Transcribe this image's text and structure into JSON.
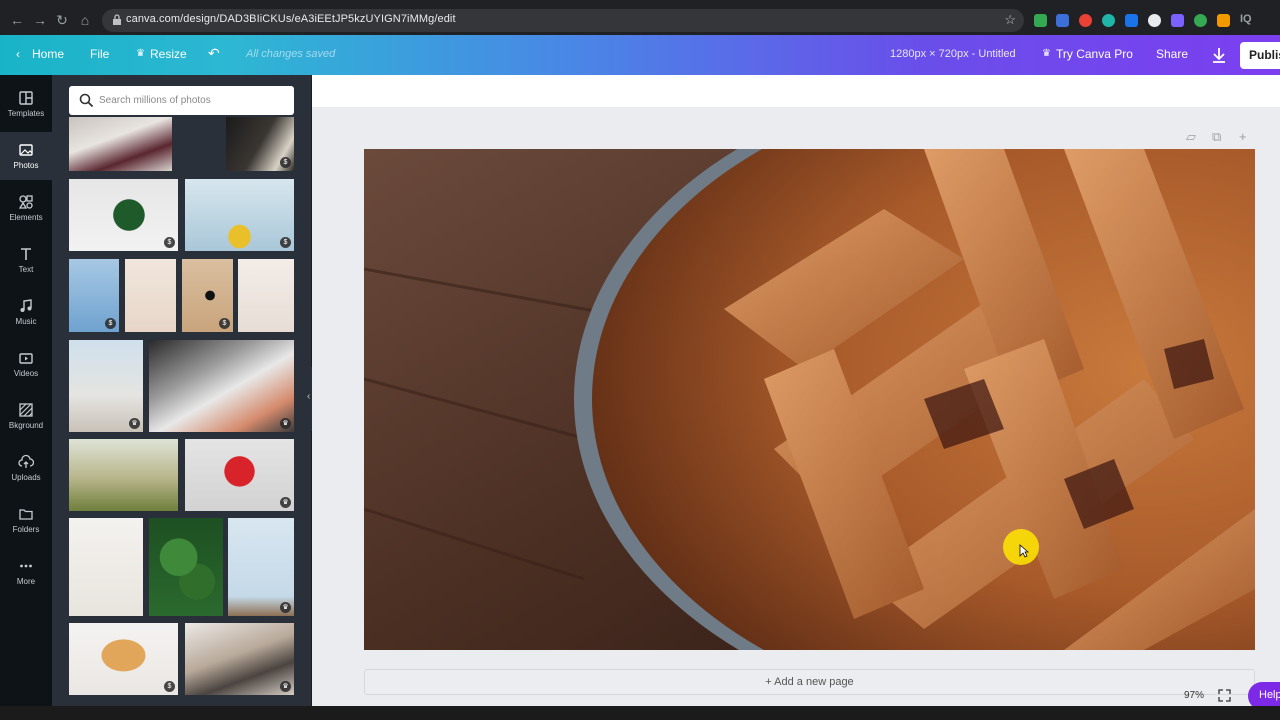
{
  "browser": {
    "url": "canva.com/design/DAD3BIiCKUs/eA3iEEtJP5kzUYIGN7iMMg/edit",
    "extensions": [
      "ext-green",
      "ext-shield",
      "ext-red-badge",
      "ext-teal",
      "ext-blue",
      "ext-white",
      "ext-lightning",
      "ext-google",
      "ext-orange",
      "IQ"
    ]
  },
  "topbar": {
    "home_label": "Home",
    "file_label": "File",
    "resize_label": "Resize",
    "save_status": "All changes saved",
    "design_info": "1280px × 720px - Untitled",
    "try_pro_label": "Try Canva Pro",
    "share_label": "Share",
    "publish_label": "Publis"
  },
  "rail": {
    "items": [
      {
        "label": "Templates",
        "icon": "templates-icon"
      },
      {
        "label": "Photos",
        "icon": "photos-icon"
      },
      {
        "label": "Elements",
        "icon": "elements-icon"
      },
      {
        "label": "Text",
        "icon": "text-icon"
      },
      {
        "label": "Music",
        "icon": "music-icon"
      },
      {
        "label": "Videos",
        "icon": "videos-icon"
      },
      {
        "label": "Bkground",
        "icon": "background-icon"
      },
      {
        "label": "Uploads",
        "icon": "uploads-icon"
      },
      {
        "label": "Folders",
        "icon": "folders-icon"
      },
      {
        "label": "More",
        "icon": "more-icon"
      }
    ],
    "active": "Photos"
  },
  "panel": {
    "search_placeholder": "Search millions of photos",
    "badges": {
      "paid": "$",
      "pro": "♛"
    }
  },
  "canvas": {
    "add_page_label": "+ Add a new page",
    "zoom": "97%",
    "help_label": "Help"
  },
  "colors": {
    "gradient_start": "#19b3c7",
    "gradient_end": "#7b3ff0",
    "rail_bg": "#0e1318",
    "panel_bg": "#293039",
    "help_purple": "#7d2ae8"
  }
}
